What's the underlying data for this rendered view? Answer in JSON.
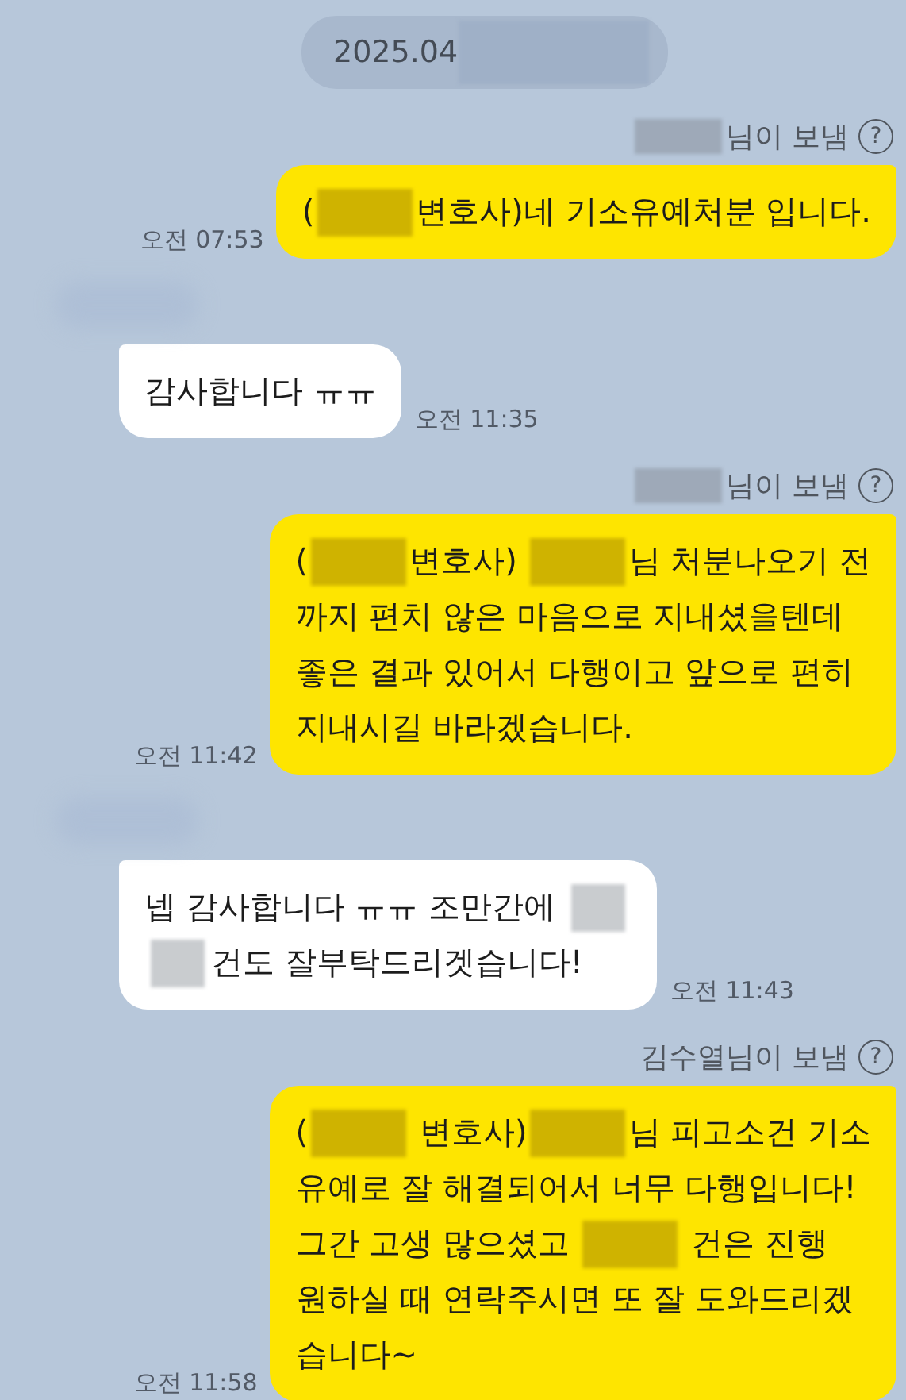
{
  "messages": [
    {
      "kind": "date",
      "parts": [
        {
          "kind": "text",
          "text": "2025.04"
        },
        {
          "kind": "redacted"
        }
      ]
    },
    {
      "kind": "sent",
      "sender": [
        {
          "kind": "redacted"
        },
        {
          "kind": "text",
          "text": "님이 보냄"
        }
      ],
      "help": "?",
      "time": "오전 07:53",
      "lines": [
        [
          {
            "kind": "text",
            "text": "("
          },
          {
            "kind": "redacted"
          },
          {
            "kind": "text",
            "text": "변호사)네 기소유예처분 입니다."
          }
        ]
      ]
    },
    {
      "kind": "received",
      "sender_hidden": true,
      "time": "오전 11:35",
      "lines": [
        [
          {
            "kind": "text",
            "text": "감사합니다 ㅠㅠ"
          }
        ]
      ]
    },
    {
      "kind": "sent",
      "sender": [
        {
          "kind": "redacted"
        },
        {
          "kind": "text",
          "text": "님이 보냄"
        }
      ],
      "help": "?",
      "time": "오전 11:42",
      "lines": [
        [
          {
            "kind": "text",
            "text": "("
          },
          {
            "kind": "redacted"
          },
          {
            "kind": "text",
            "text": "변호사) "
          },
          {
            "kind": "redacted"
          },
          {
            "kind": "text",
            "text": "님 처분나오기 전"
          }
        ],
        [
          {
            "kind": "text",
            "text": "까지 편치 않은 마음으로 지내셨을텐데"
          }
        ],
        [
          {
            "kind": "text",
            "text": "좋은 결과 있어서 다행이고 앞으로 편히"
          }
        ],
        [
          {
            "kind": "text",
            "text": "지내시길 바라겠습니다."
          }
        ]
      ]
    },
    {
      "kind": "received",
      "sender_hidden": true,
      "time": "오전 11:43",
      "lines": [
        [
          {
            "kind": "text",
            "text": "넵 감사합니다 ㅠㅠ 조만간에 "
          },
          {
            "kind": "redacted"
          }
        ],
        [
          {
            "kind": "redacted"
          },
          {
            "kind": "text",
            "text": "건도 잘부탁드리겟습니다!"
          }
        ]
      ]
    },
    {
      "kind": "sent",
      "sender": [
        {
          "kind": "text",
          "text": "김수열님이 보냄"
        }
      ],
      "help": "?",
      "time": "오전 11:58",
      "lines": [
        [
          {
            "kind": "text",
            "text": "("
          },
          {
            "kind": "redacted"
          },
          {
            "kind": "text",
            "text": " 변호사)"
          },
          {
            "kind": "redacted"
          },
          {
            "kind": "text",
            "text": "님 피고소건 기소"
          }
        ],
        [
          {
            "kind": "text",
            "text": "유예로 잘 해결되어서 너무 다행입니다!"
          }
        ],
        [
          {
            "kind": "text",
            "text": "그간 고생 많으셨고 "
          },
          {
            "kind": "redacted"
          },
          {
            "kind": "text",
            "text": " 건은 진행"
          }
        ],
        [
          {
            "kind": "text",
            "text": "원하실 때 연락주시면 또 잘 도와드리겠"
          }
        ],
        [
          {
            "kind": "text",
            "text": "습니다~"
          }
        ]
      ]
    }
  ]
}
